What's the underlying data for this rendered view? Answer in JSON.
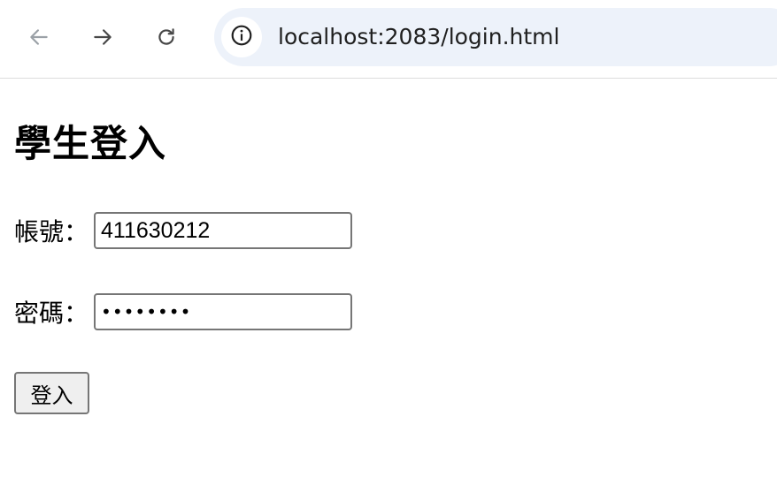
{
  "browser": {
    "url": "localhost:2083/login.html",
    "icons": {
      "back": "arrow-left-icon",
      "forward": "arrow-right-icon",
      "reload": "reload-icon",
      "site_info": "info-icon"
    },
    "back_enabled": false
  },
  "page": {
    "title": "學生登入",
    "form": {
      "account_label": "帳號：",
      "account_value": "411630212",
      "password_label": "密碼：",
      "password_value": "••••••••",
      "submit_label": "登入"
    }
  },
  "colors": {
    "omnibox_bg": "#edf2fa",
    "nav_disabled": "#9aa0a6",
    "nav_enabled": "#474747",
    "input_border": "#767676",
    "button_bg": "#efefef"
  }
}
